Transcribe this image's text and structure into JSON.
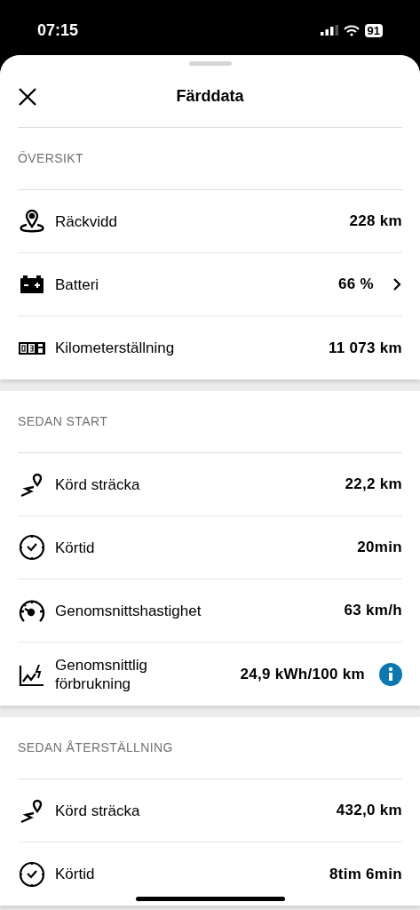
{
  "status_bar": {
    "time": "07:15",
    "battery": "91"
  },
  "header": {
    "title": "Färddata"
  },
  "sections": [
    {
      "title": "ÖVERSIKT",
      "rows": [
        {
          "kind": "range",
          "label": "Räckvidd",
          "value": "228 km",
          "chevron": false,
          "info": false
        },
        {
          "kind": "battery",
          "label": "Batteri",
          "value": "66 %",
          "chevron": true,
          "info": false
        },
        {
          "kind": "odometer",
          "label": "Kilometerställning",
          "value": "11 073 km",
          "chevron": false,
          "info": false
        }
      ]
    },
    {
      "title": "SEDAN START",
      "rows": [
        {
          "kind": "distance",
          "label": "Körd sträcka",
          "value": "22,2 km",
          "chevron": false,
          "info": false
        },
        {
          "kind": "time",
          "label": "Körtid",
          "value": "20min",
          "chevron": false,
          "info": false
        },
        {
          "kind": "speed",
          "label": "Genomsnittshastighet",
          "value": "63 km/h",
          "chevron": false,
          "info": false
        },
        {
          "kind": "consumption",
          "label": "Genomsnittlig förbrukning",
          "value": "24,9 kWh/100 km",
          "chevron": false,
          "info": true
        }
      ]
    },
    {
      "title": "SEDAN ÅTERSTÄLLNING",
      "rows": [
        {
          "kind": "distance",
          "label": "Körd sträcka",
          "value": "432,0 km",
          "chevron": false,
          "info": false
        },
        {
          "kind": "time",
          "label": "Körtid",
          "value": "8tim 6min",
          "chevron": false,
          "info": false
        }
      ]
    }
  ]
}
